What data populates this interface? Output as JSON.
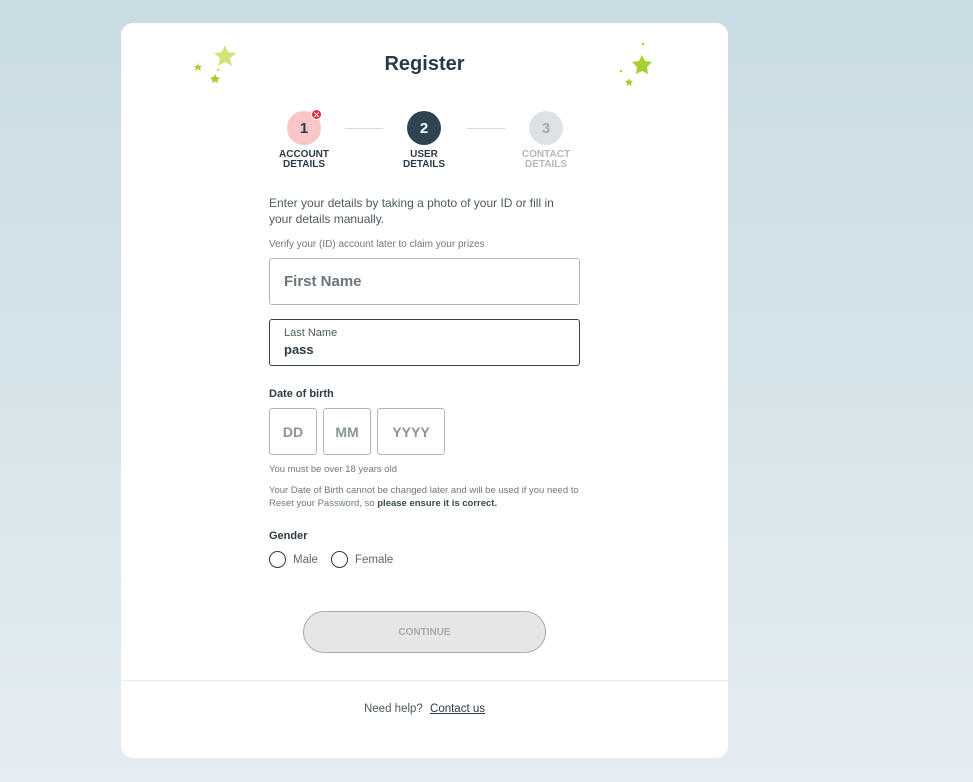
{
  "title": "Register",
  "stepper": {
    "steps": [
      {
        "number": "1",
        "label_line1": "ACCOUNT",
        "label_line2": "DETAILS",
        "state": "error"
      },
      {
        "number": "2",
        "label_line1": "USER",
        "label_line2": "DETAILS",
        "state": "active"
      },
      {
        "number": "3",
        "label_line1": "CONTACT",
        "label_line2": "DETAILS",
        "state": "pending"
      }
    ],
    "error_glyph": "✕"
  },
  "form": {
    "intro": "Enter your details by taking a photo of your ID or fill in your details manually.",
    "verify_note": "Verify your (ID) account later to claim your prizes",
    "first_name": {
      "placeholder": "First Name",
      "value": ""
    },
    "last_name": {
      "label": "Last Name",
      "value": "pass"
    },
    "dob": {
      "label": "Date of birth",
      "dd_placeholder": "DD",
      "mm_placeholder": "MM",
      "yyyy_placeholder": "YYYY",
      "age_note": "You must be over 18 years old",
      "warning_text": "Your Date of Birth cannot be changed later and will be used if you need to Reset your Password, so ",
      "warning_bold": "please ensure it is correct."
    },
    "gender": {
      "label": "Gender",
      "options": [
        "Male",
        "Female"
      ]
    },
    "continue_label": "CONTINUE"
  },
  "footer": {
    "help_text": "Need help?",
    "contact_link": "Contact us"
  },
  "colors": {
    "primary": "#2d4550",
    "error": "#e22a3c",
    "star": "#a6cf2f"
  }
}
